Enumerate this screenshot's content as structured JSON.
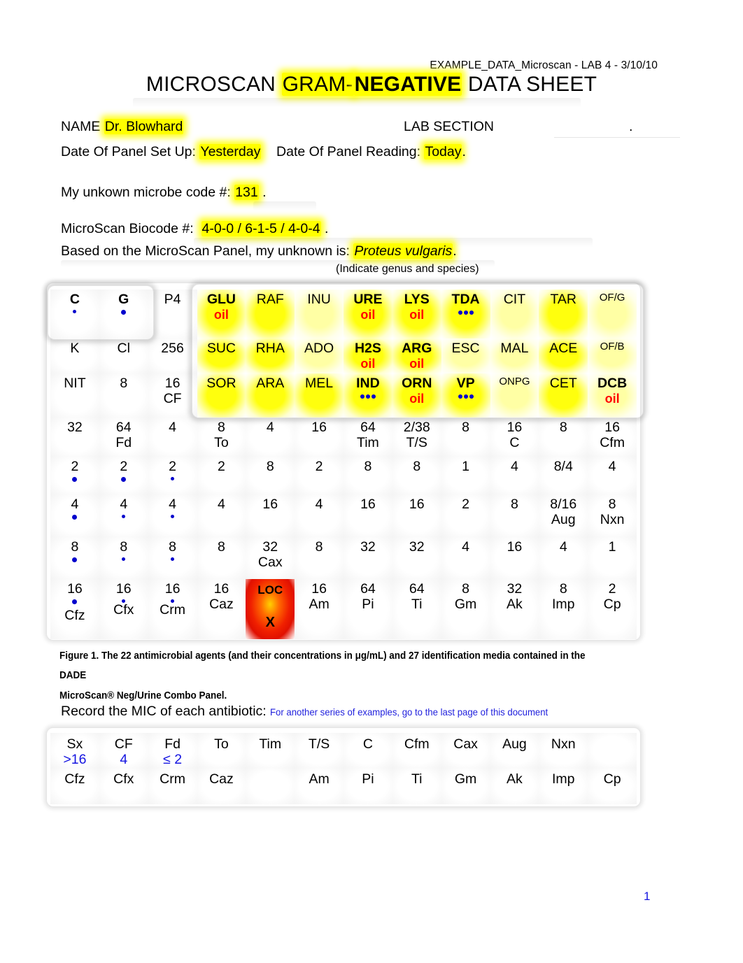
{
  "header": {
    "doc_meta": "EXAMPLE_DATA_Microscan - LAB 4 - 3/10/10",
    "title_part1": "MICROSCAN ",
    "title_gram": "GRAM-",
    "title_negative": "NEGATIVE",
    "title_part2": " DATA SHEET"
  },
  "form": {
    "name_label": "NAME",
    "name_value": "Dr. Blowhard",
    "lab_section_label": "LAB SECTION",
    "lab_section_value": "",
    "lab_section_period": ".",
    "setup_label": "Date Of Panel Set Up:",
    "setup_value": "Yesterday",
    "reading_label": "Date Of Panel Reading:",
    "reading_value": "Today",
    "reading_period": ".",
    "microbe_label": "My unkown microbe code #:",
    "microbe_value": "131",
    "microbe_period": ".",
    "biocode_label": "MicroScan Biocode #:",
    "biocode_value": "4-0-0 / 6-1-5 / 4-0-4",
    "biocode_period": "."
  },
  "identification": {
    "prefix": "Based on the MicroScan Panel, my unknown is:",
    "organism": "Proteus vulgaris",
    "period": ".",
    "subnote": "(Indicate genus and species)"
  },
  "panel": {
    "rows": [
      [
        {
          "l1": "C",
          "bold1": true,
          "dot": "small"
        },
        {
          "l1": "G",
          "bold1": true,
          "dot": "large"
        },
        {
          "l1": "P4"
        },
        {
          "l1": "GLU",
          "bold1": true,
          "l2": "oil",
          "oil": true,
          "hl": "strong"
        },
        {
          "l1": "RAF",
          "hl": "strong"
        },
        {
          "l1": "INU",
          "hl": "lite"
        },
        {
          "l1": "URE",
          "bold1": true,
          "l2": "oil",
          "oil": true,
          "hl": "strong"
        },
        {
          "l1": "LYS",
          "bold1": true,
          "l2": "oil",
          "oil": true,
          "hl": "strong"
        },
        {
          "l1": "TDA",
          "bold1": true,
          "dots3": true,
          "hl": "strong"
        },
        {
          "l1": "CIT",
          "hl": "lite"
        },
        {
          "l1": "TAR",
          "hl": "strong"
        },
        {
          "l1": "OF/G",
          "small1": true,
          "hl": "lite"
        }
      ],
      [
        {
          "l1": "K"
        },
        {
          "l1": "Cl"
        },
        {
          "l1": "256"
        },
        {
          "l1": "SUC",
          "hl": "strong"
        },
        {
          "l1": "RHA",
          "hl": "strong"
        },
        {
          "l1": "ADO",
          "hl": "lite"
        },
        {
          "l1": "H2S",
          "bold1": true,
          "l2": "oil",
          "oil": true,
          "hl": "strong"
        },
        {
          "l1": "ARG",
          "bold1": true,
          "l2": "oil",
          "oil": true,
          "hl": "strong"
        },
        {
          "l1": "ESC",
          "hl": "lite"
        },
        {
          "l1": "MAL",
          "hl": "lite"
        },
        {
          "l1": "ACE",
          "hl": "strong"
        },
        {
          "l1": "OF/B",
          "small1": true,
          "hl": "lite"
        }
      ],
      [
        {
          "l1": "NIT"
        },
        {
          "l1": "8"
        },
        {
          "l1": "16",
          "l2": "CF"
        },
        {
          "l1": "SOR",
          "hl": "strong"
        },
        {
          "l1": "ARA",
          "hl": "strong"
        },
        {
          "l1": "MEL",
          "hl": "strong"
        },
        {
          "l1": "IND",
          "bold1": true,
          "dots3": true,
          "hl": "strong"
        },
        {
          "l1": "ORN",
          "bold1": true,
          "l2": "oil",
          "oil": true,
          "hl": "strong"
        },
        {
          "l1": "VP",
          "bold1": true,
          "dots3": true,
          "hl": "strong"
        },
        {
          "l1": "ONPG",
          "small1": true,
          "hl": "lite"
        },
        {
          "l1": "CET",
          "hl": "strong"
        },
        {
          "l1": "DCB",
          "bold1": true,
          "l2": "oil",
          "oil": true,
          "hl": "lite"
        }
      ],
      [
        {
          "l1": "32"
        },
        {
          "l1": "64",
          "l2": "Fd"
        },
        {
          "l1": "4"
        },
        {
          "l1": "8",
          "l2": "To"
        },
        {
          "l1": "4"
        },
        {
          "l1": "16"
        },
        {
          "l1": "64",
          "l2": "Tim"
        },
        {
          "l1": "2/38",
          "l2": "T/S"
        },
        {
          "l1": "8"
        },
        {
          "l1": "16",
          "l2": "C"
        },
        {
          "l1": "8"
        },
        {
          "l1": "16",
          "l2": "Cfm"
        }
      ],
      [
        {
          "l1": "2",
          "dot": "large"
        },
        {
          "l1": "2",
          "dot": "large"
        },
        {
          "l1": "2",
          "dot": "small"
        },
        {
          "l1": "2"
        },
        {
          "l1": "8"
        },
        {
          "l1": "2"
        },
        {
          "l1": "8"
        },
        {
          "l1": "8"
        },
        {
          "l1": "1"
        },
        {
          "l1": "4"
        },
        {
          "l1": "8/4"
        },
        {
          "l1": "4"
        }
      ],
      [
        {
          "l1": "4",
          "dot": "large"
        },
        {
          "l1": "4",
          "dot": "small"
        },
        {
          "l1": "4",
          "dot": "small"
        },
        {
          "l1": "4"
        },
        {
          "l1": "16"
        },
        {
          "l1": "4"
        },
        {
          "l1": "16"
        },
        {
          "l1": "16"
        },
        {
          "l1": "2"
        },
        {
          "l1": "8"
        },
        {
          "l1": "8/16",
          "l2": "Aug"
        },
        {
          "l1": "8",
          "l2": "Nxn"
        }
      ],
      [
        {
          "l1": "8",
          "dot": "large"
        },
        {
          "l1": "8",
          "dot": "small"
        },
        {
          "l1": "8",
          "dot": "small"
        },
        {
          "l1": "8"
        },
        {
          "l1": "32",
          "l2": "Cax"
        },
        {
          "l1": "8"
        },
        {
          "l1": "32"
        },
        {
          "l1": "32"
        },
        {
          "l1": "4"
        },
        {
          "l1": "16"
        },
        {
          "l1": "4"
        },
        {
          "l1": "1"
        }
      ],
      [
        {
          "l1": "16",
          "dot": "large",
          "l3": "Cfz"
        },
        {
          "l1": "16",
          "dot": "small",
          "l2": "Cfx"
        },
        {
          "l1": "16",
          "dot": "small",
          "l2": "Crm"
        },
        {
          "l1": "16",
          "l2": "Caz"
        },
        {
          "l1": "LOC",
          "l2": "X",
          "red": true
        },
        {
          "l1": "16",
          "l2": "Am"
        },
        {
          "l1": "64",
          "l2": "Pi"
        },
        {
          "l1": "64",
          "l2": "Ti"
        },
        {
          "l1": "8",
          "l2": "Gm"
        },
        {
          "l1": "32",
          "l2": "Ak"
        },
        {
          "l1": "8",
          "l2": "Imp"
        },
        {
          "l1": "2",
          "l2": "Cp"
        }
      ]
    ]
  },
  "caption": {
    "line1": "Figure 1.  The 22 antimicrobial agents (and their concentrations in μg/mL) and 27 identification media contained in the DADE",
    "line2": "MicroScan® Neg/Urine Combo Panel."
  },
  "record": {
    "label": "Record the MIC of each antibiotic:",
    "note": "For another series of examples, go to the last page of this document"
  },
  "mic_table": {
    "row1": [
      {
        "name": "Sx",
        "value": ">16"
      },
      {
        "name": "CF",
        "value": "4"
      },
      {
        "name": "Fd",
        "value": "≤ 2"
      },
      {
        "name": "To",
        "value": ""
      },
      {
        "name": "Tim",
        "value": ""
      },
      {
        "name": "T/S",
        "value": ""
      },
      {
        "name": "C",
        "value": ""
      },
      {
        "name": "Cfm",
        "value": ""
      },
      {
        "name": "Cax",
        "value": ""
      },
      {
        "name": "Aug",
        "value": ""
      },
      {
        "name": "Nxn",
        "value": ""
      },
      {
        "name": "",
        "value": ""
      }
    ],
    "row2": [
      {
        "name": "Cfz",
        "value": ""
      },
      {
        "name": "Cfx",
        "value": ""
      },
      {
        "name": "Crm",
        "value": ""
      },
      {
        "name": "Caz",
        "value": ""
      },
      {
        "name": "",
        "value": ""
      },
      {
        "name": "Am",
        "value": ""
      },
      {
        "name": "Pi",
        "value": ""
      },
      {
        "name": "Ti",
        "value": ""
      },
      {
        "name": "Gm",
        "value": ""
      },
      {
        "name": "Ak",
        "value": ""
      },
      {
        "name": "Imp",
        "value": ""
      },
      {
        "name": "Cp",
        "value": ""
      }
    ]
  },
  "footer": {
    "page_number": "1"
  },
  "colors": {
    "highlight": "#ffff00",
    "oil_red": "#ff0000",
    "dot_blue": "#0000cc",
    "note_blue": "#2222dd",
    "loc_red": "#f02000"
  }
}
